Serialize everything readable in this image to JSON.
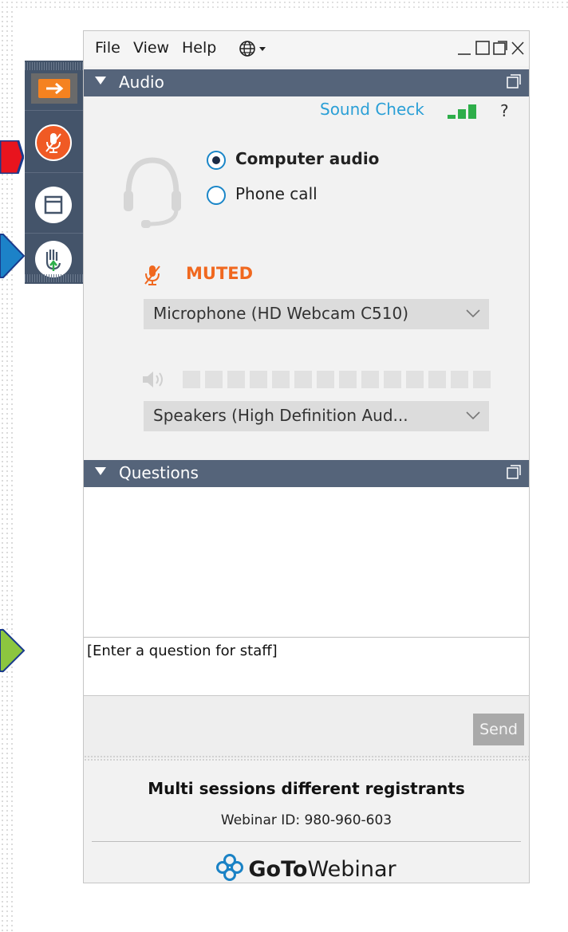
{
  "menubar": {
    "file": "File",
    "view": "View",
    "help": "Help"
  },
  "audio_panel": {
    "title": "Audio",
    "sound_check": "Sound Check",
    "help_mark": "?",
    "options": {
      "computer_audio": "Computer audio",
      "phone_call": "Phone call"
    },
    "selected_option": "Computer audio",
    "mute_status": "MUTED",
    "microphone": "Microphone (HD Webcam C510)",
    "speakers": "Speakers (High Definition Aud...",
    "speaker_level": 0
  },
  "questions_panel": {
    "title": "Questions",
    "input_placeholder": "[Enter a question for staff]",
    "send_label": "Send"
  },
  "footer": {
    "session_title": "Multi sessions different registrants",
    "webinar_id": "Webinar ID: 980-960-603",
    "brand_bold": "GoTo",
    "brand_light": "Webinar"
  },
  "colors": {
    "header_bg": "#55647a",
    "accent_blue": "#2a9fd6",
    "muted_orange": "#f0681f",
    "toolbar_bg": "#44546a"
  }
}
